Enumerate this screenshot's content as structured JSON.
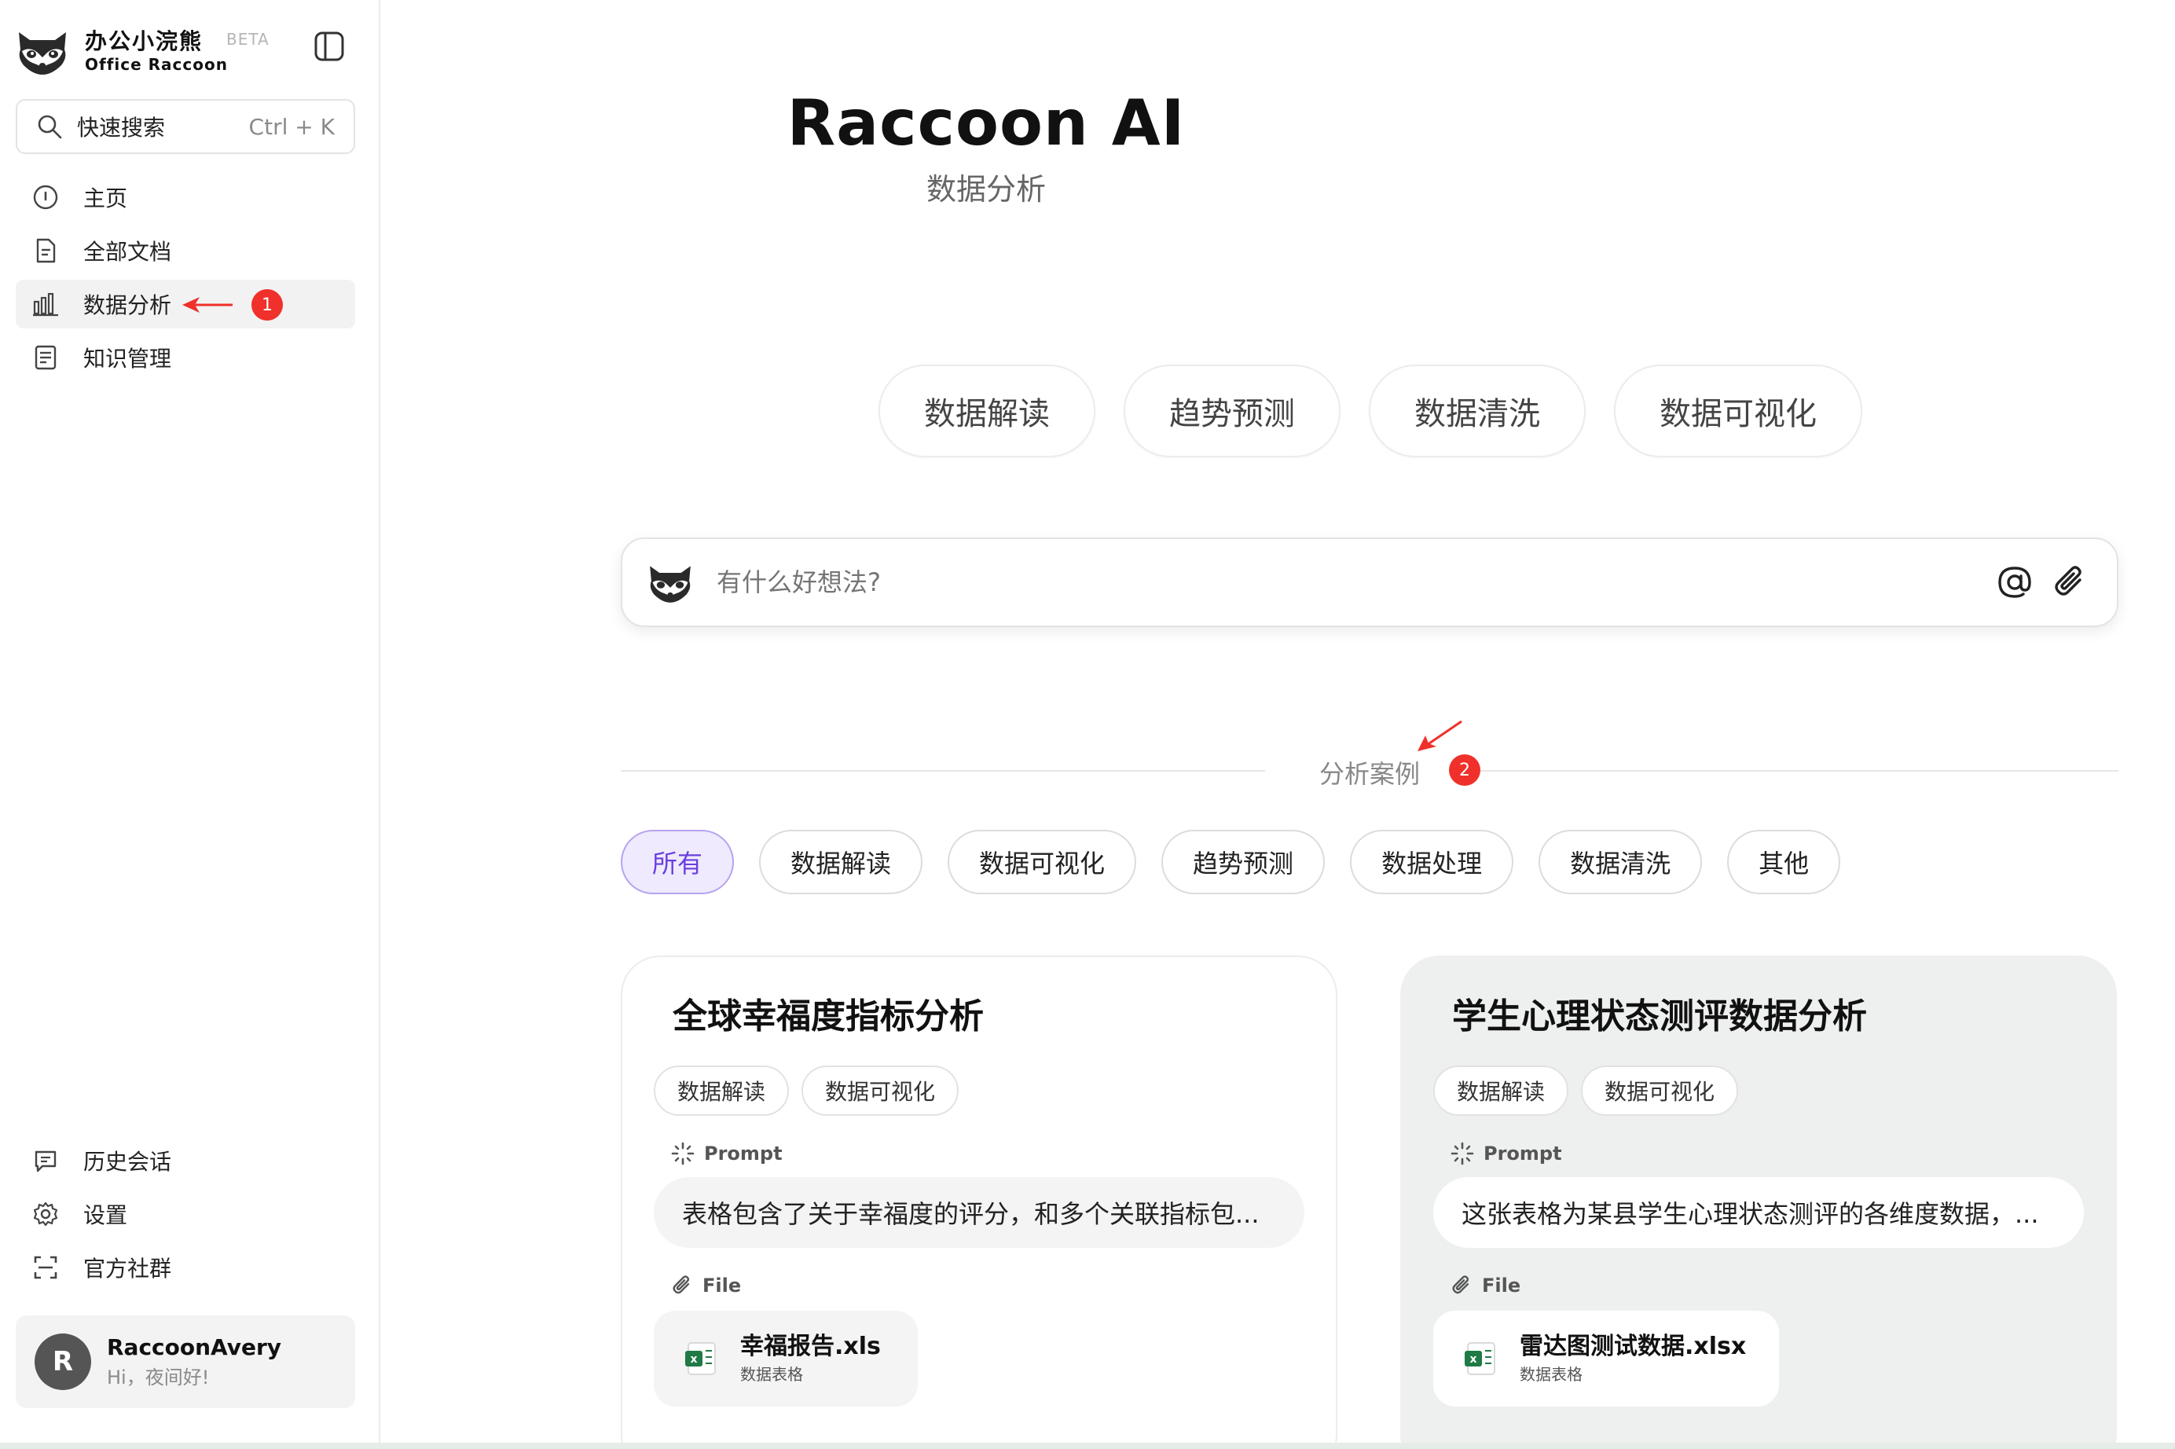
{
  "brand": {
    "name_cn": "办公小浣熊",
    "name_en": "Office Raccoon",
    "beta": "BETA"
  },
  "search": {
    "label": "快速搜索",
    "shortcut": "Ctrl + K"
  },
  "nav": {
    "items": [
      {
        "label": "主页",
        "icon": "info-circle-icon"
      },
      {
        "label": "全部文档",
        "icon": "document-icon"
      },
      {
        "label": "数据分析",
        "icon": "bar-chart-icon",
        "active": true
      },
      {
        "label": "知识管理",
        "icon": "notebook-icon"
      }
    ],
    "bottom": [
      {
        "label": "历史会话",
        "icon": "chat-history-icon"
      },
      {
        "label": "设置",
        "icon": "gear-icon"
      },
      {
        "label": "官方社群",
        "icon": "scan-icon"
      }
    ]
  },
  "annotations": {
    "badge1": "1",
    "badge2": "2",
    "color": "#f0302a"
  },
  "user": {
    "initial": "R",
    "name": "RaccoonAvery",
    "greeting": "Hi，夜间好!"
  },
  "main": {
    "title": "Raccoon AI",
    "subtitle": "数据分析",
    "quick_actions": [
      "数据解读",
      "趋势预测",
      "数据清洗",
      "数据可视化"
    ],
    "ask_placeholder": "有什么好想法?",
    "section_title": "分析案例",
    "filters": [
      "所有",
      "数据解读",
      "数据可视化",
      "趋势预测",
      "数据处理",
      "数据清洗",
      "其他"
    ],
    "active_filter": "所有",
    "accent_color": "#6a3fe0"
  },
  "cards": [
    {
      "title": "全球幸福度指标分析",
      "tags": [
        "数据解读",
        "数据可视化"
      ],
      "prompt_label": "Prompt",
      "prompt": "表格包含了关于幸福度的评分，和多个关联指标包...",
      "file_label": "File",
      "file_name": "幸福报告.xls",
      "file_type": "数据表格"
    },
    {
      "title": "学生心理状态测评数据分析",
      "tags": [
        "数据解读",
        "数据可视化"
      ],
      "prompt_label": "Prompt",
      "prompt": "这张表格为某县学生心理状态测评的各维度数据，...",
      "file_label": "File",
      "file_name": "雷达图测试数据.xlsx",
      "file_type": "数据表格"
    }
  ]
}
